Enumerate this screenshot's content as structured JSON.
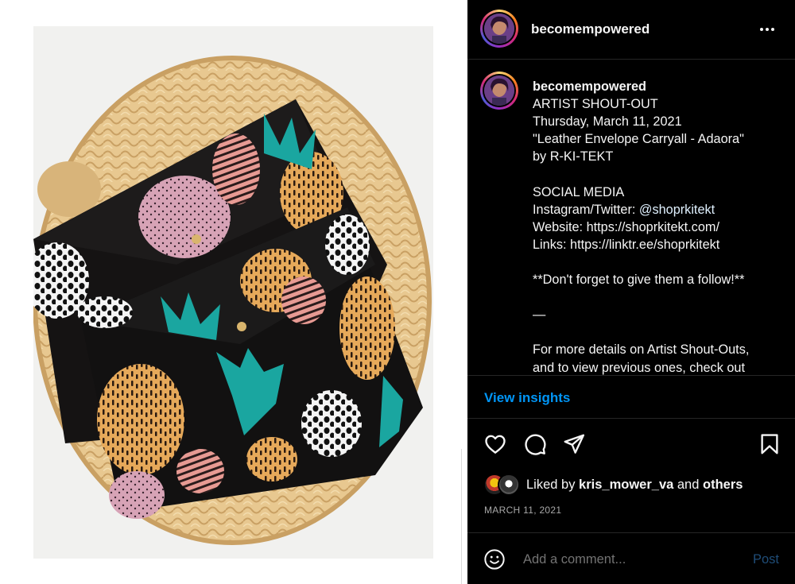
{
  "header": {
    "username": "becomempowered",
    "more_icon": "more-horizontal-icon"
  },
  "caption": {
    "username": "becomempowered",
    "lines": [
      "ARTIST SHOUT-OUT",
      "Thursday, March 11, 2021",
      "\"Leather Envelope Carryall - Adaora\"",
      "by R-KI-TEKT",
      "",
      "SOCIAL MEDIA"
    ],
    "instagram_prefix": "Instagram/Twitter: ",
    "instagram_handle": "@shoprkitekt",
    "lines_after": [
      "Website: https://shoprkitekt.com/",
      "Links: https://linktr.ee/shoprkitekt",
      "",
      "**Don't forget to give them a follow!**",
      "",
      "—",
      "",
      "For more details on Artist Shout-Outs,",
      "and to view previous ones, check out"
    ]
  },
  "insights_label": "View insights",
  "actions": {
    "like_icon": "heart-icon",
    "comment_icon": "comment-icon",
    "share_icon": "send-icon",
    "save_icon": "bookmark-icon"
  },
  "likes": {
    "prefix": "Liked by ",
    "user": "kris_mower_va",
    "middle": " and ",
    "others": "others"
  },
  "date": "MARCH 11, 2021",
  "comment": {
    "placeholder": "Add a comment...",
    "post_label": "Post",
    "emoji_icon": "smiley-icon"
  },
  "colors": {
    "panel_bg": "#000000",
    "link_blue": "#0095f6",
    "post_disabled": "#1f4d78",
    "muted": "#a8a8a8"
  }
}
